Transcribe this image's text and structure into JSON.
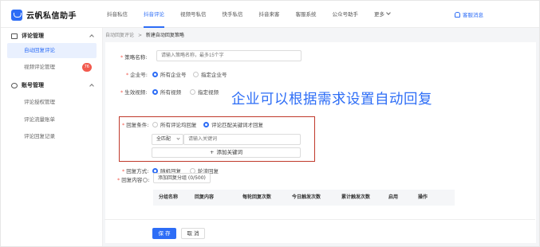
{
  "app": {
    "name": "云帆私信助手"
  },
  "nav": {
    "items": [
      "抖音私信",
      "抖音评论",
      "视频号私信",
      "快手私信",
      "抖音来客",
      "客服系统",
      "公众号助手"
    ],
    "more": "更多",
    "notification": "客服消息"
  },
  "sidebar": {
    "section1": {
      "title": "评论管理",
      "items": [
        "自动回复评论",
        "视频评论管理"
      ],
      "badge": "76"
    },
    "section2": {
      "title": "账号管理",
      "items": [
        "评论授权管理",
        "评论流量账单",
        "评论回复记录"
      ]
    }
  },
  "breadcrumb": {
    "parent": "自动回复评论",
    "separator": ">",
    "current": "新建自动回复策略"
  },
  "form": {
    "strategy_name": {
      "label": "策略名称:",
      "placeholder": "请输入策略名称，最多15个字"
    },
    "enterprise": {
      "label": "企业号:",
      "options": [
        "所有企业号",
        "指定企业号"
      ]
    },
    "video": {
      "label": "生效视频:",
      "options": [
        "所有视频",
        "指定视频"
      ]
    },
    "condition": {
      "label": "回复条件:",
      "options": [
        "所有评论均回复",
        "评论匹配关键词才回复"
      ],
      "match_select": "全匹配",
      "keyword_placeholder": "请输入关键词",
      "add_keyword": "添加关键词"
    },
    "method": {
      "label": "回复方式:",
      "options": [
        "随机回复",
        "轮流回复"
      ]
    },
    "content": {
      "label": "回复内容",
      "add_group": "添加回复分组 (0/500)"
    },
    "table_headers": [
      "分组名称",
      "回复内容",
      "每轮回复次数",
      "今日触发次数",
      "累计触发次数",
      "启用",
      "操作"
    ]
  },
  "overlay_text": "企业可以根据需求设置自动回复",
  "buttons": {
    "save": "保 存",
    "cancel": "取 消"
  },
  "colors": {
    "accent": "#2d6df6",
    "highlight_box": "#c0392b",
    "badge": "#f25a4e"
  }
}
